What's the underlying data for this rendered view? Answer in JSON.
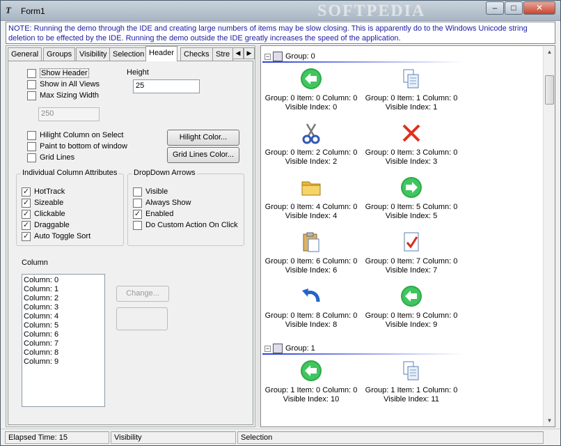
{
  "window": {
    "title": "Form1",
    "watermark": "SOFTPEDIA",
    "min_label": "–",
    "max_label": "□",
    "close_label": "✕"
  },
  "note": "NOTE:  Running the demo through the IDE and creating large numbers of items may be slow closing.  This is apparently do to the Windows Unicode string deletion to be effected by the IDE.  Running the demo outside the IDE greatly increases the speed of the application.",
  "tabs": [
    "General",
    "Groups",
    "Visibility",
    "Selection",
    "Header",
    "Checks",
    "Stre"
  ],
  "active_tab": "Header",
  "header_tab": {
    "show_header": "Show Header",
    "show_in_all_views": "Show in All Views",
    "max_sizing_width": "Max Sizing Width",
    "height_label": "Height",
    "height_value": "25",
    "max_width_value": "250",
    "hilight_column": "Hilight Column on Select",
    "paint_to_bottom": "Paint to bottom of window",
    "grid_lines": "Grid Lines",
    "hilight_color_button": "Hilight Color...",
    "grid_lines_color_button": "Grid Lines Color...",
    "column_attributes_title": "Individual Column Attributes",
    "column_attributes": [
      {
        "label": "HotTrack",
        "checked": true
      },
      {
        "label": "Sizeable",
        "checked": true
      },
      {
        "label": "Clickable",
        "checked": true
      },
      {
        "label": "Draggable",
        "checked": true
      },
      {
        "label": "Auto Toggle Sort",
        "checked": true
      }
    ],
    "dropdown_title": "DropDown Arrows",
    "dropdown": [
      {
        "label": "Visible",
        "checked": false
      },
      {
        "label": "Always Show",
        "checked": false
      },
      {
        "label": "Enabled",
        "checked": true
      },
      {
        "label": "Do Custom Action On Click",
        "checked": false
      }
    ],
    "column_label": "Column",
    "columns": [
      "Column: 0",
      "Column: 1",
      "Column: 2",
      "Column: 3",
      "Column: 4",
      "Column: 5",
      "Column: 6",
      "Column: 7",
      "Column: 8",
      "Column: 9"
    ],
    "change_button": "Change..."
  },
  "groups": [
    {
      "label": "Group: 0",
      "items": [
        {
          "line1": "Group: 0 Item: 0 Column: 0",
          "line2": "Visible Index: 0",
          "icon": "arrow-left-icon"
        },
        {
          "line1": "Group: 0 Item: 1 Column: 0",
          "line2": "Visible Index: 1",
          "icon": "copy-icon"
        },
        {
          "line1": "Group: 0 Item: 2 Column: 0",
          "line2": "Visible Index: 2",
          "icon": "scissors-icon"
        },
        {
          "line1": "Group: 0 Item: 3 Column: 0",
          "line2": "Visible Index: 3",
          "icon": "delete-x-icon"
        },
        {
          "line1": "Group: 0 Item: 4 Column: 0",
          "line2": "Visible Index: 4",
          "icon": "folder-icon"
        },
        {
          "line1": "Group: 0 Item: 5 Column: 0",
          "line2": "Visible Index: 5",
          "icon": "arrow-right-icon"
        },
        {
          "line1": "Group: 0 Item: 6 Column: 0",
          "line2": "Visible Index: 6",
          "icon": "clipboard-icon"
        },
        {
          "line1": "Group: 0 Item: 7 Column: 0",
          "line2": "Visible Index: 7",
          "icon": "checked-document-icon"
        },
        {
          "line1": "Group: 0 Item: 8 Column: 0",
          "line2": "Visible Index: 8",
          "icon": "undo-icon"
        },
        {
          "line1": "Group: 0 Item: 9 Column: 0",
          "line2": "Visible Index: 9",
          "icon": "arrow-left-icon"
        }
      ]
    },
    {
      "label": "Group: 1",
      "items": [
        {
          "line1": "Group: 1 Item: 0 Column: 0",
          "line2": "Visible Index: 10",
          "icon": "arrow-left-icon"
        },
        {
          "line1": "Group: 1 Item: 1 Column: 0",
          "line2": "Visible Index: 11",
          "icon": "copy-icon"
        }
      ]
    }
  ],
  "status": {
    "elapsed": "Elapsed Time: 15",
    "panel2": "Visibility",
    "panel3": "Selection"
  }
}
